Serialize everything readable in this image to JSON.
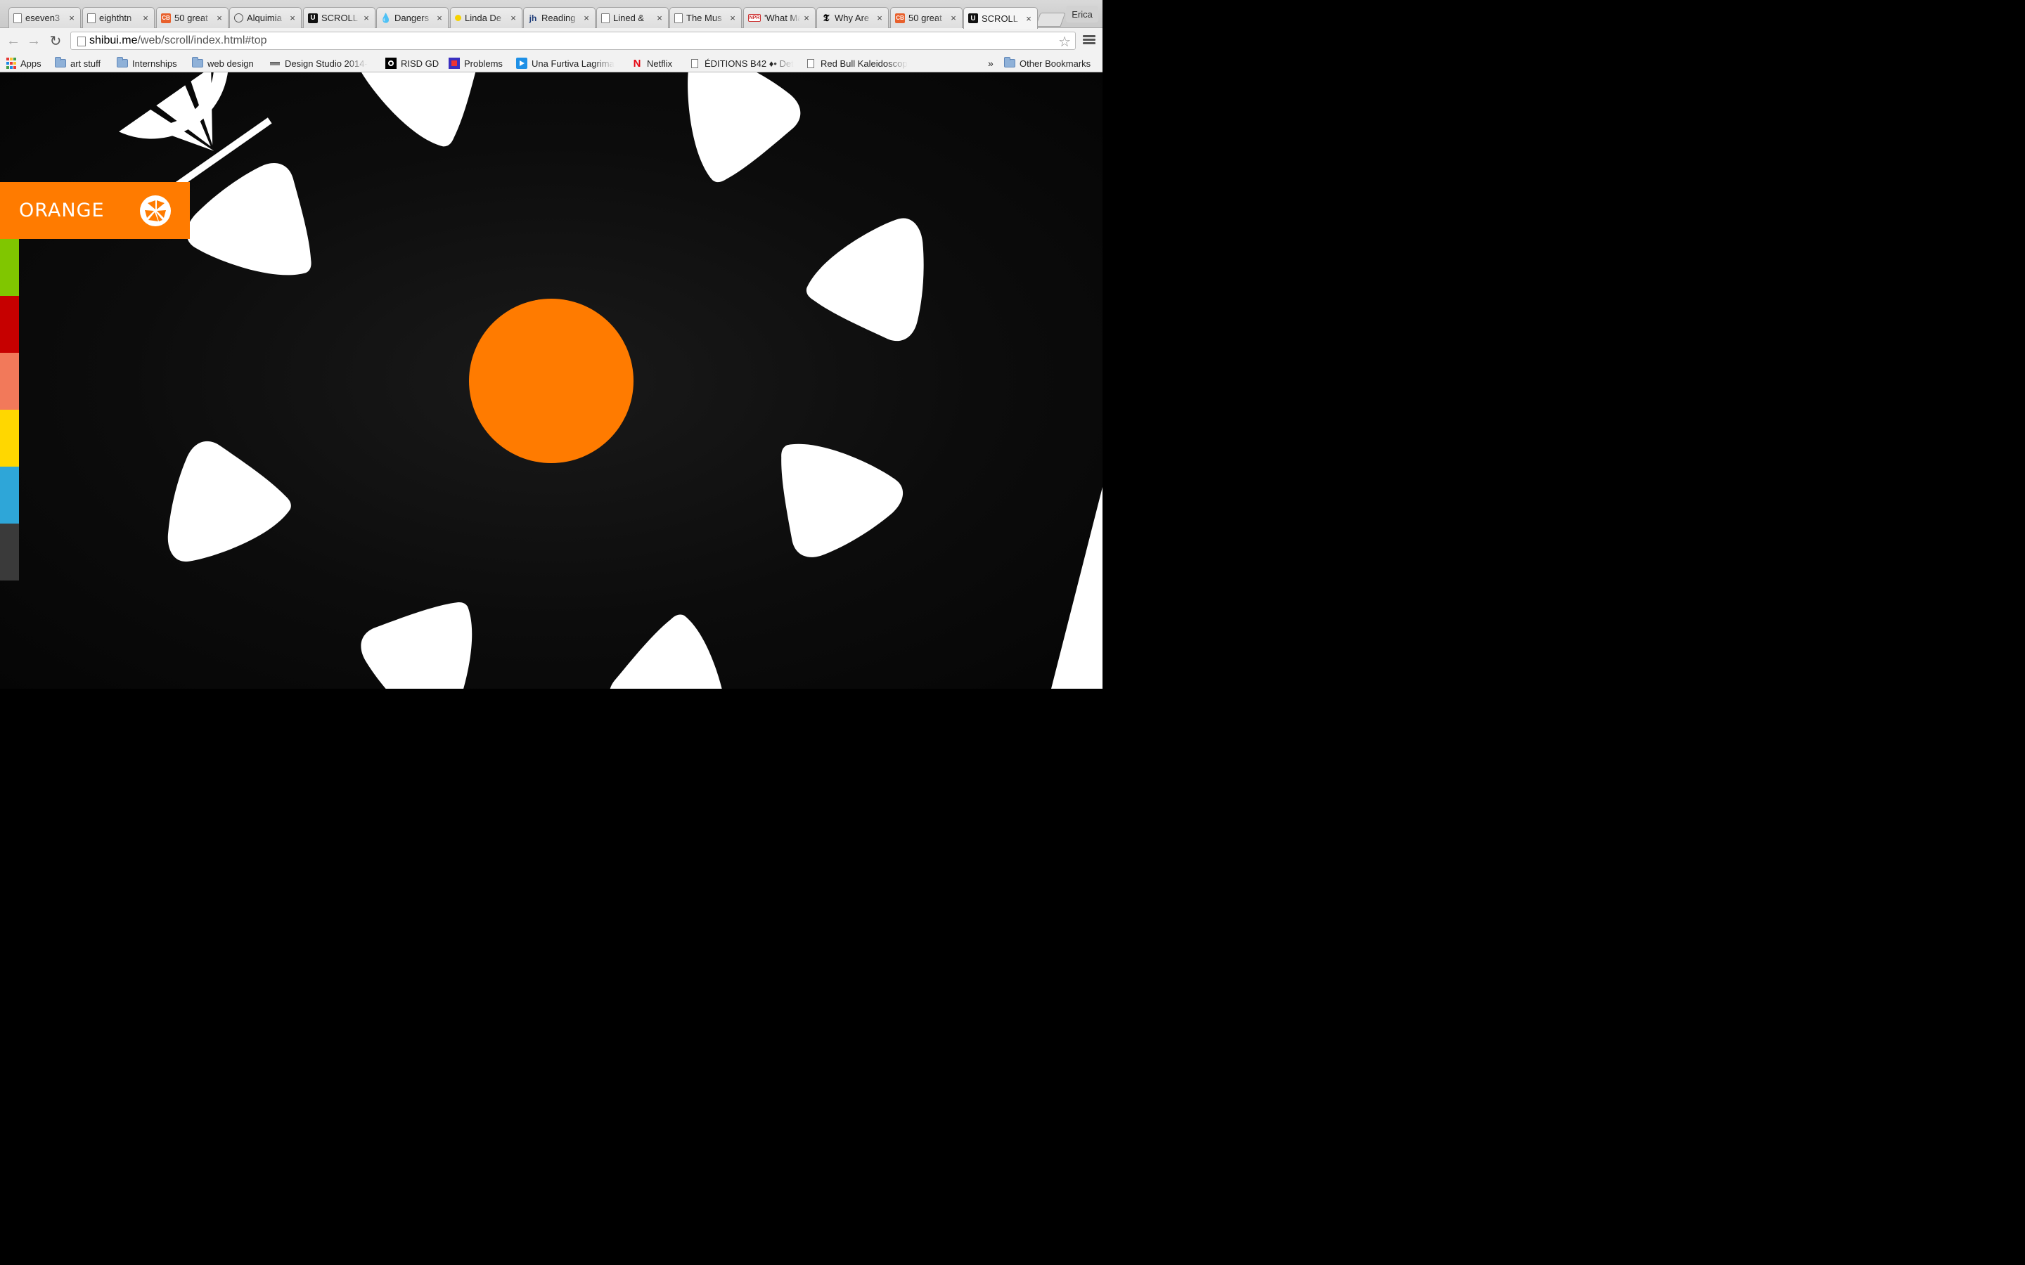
{
  "tabs": [
    {
      "title": "eseven3",
      "favicon": "page-icon",
      "active": false
    },
    {
      "title": "eighthtn",
      "favicon": "page-icon",
      "active": false
    },
    {
      "title": "50 great",
      "favicon": "cb-icon",
      "active": false
    },
    {
      "title": "Alquimia",
      "favicon": "alquimia-icon",
      "active": false
    },
    {
      "title": "SCROLL",
      "favicon": "u-icon",
      "active": false
    },
    {
      "title": "Dangers",
      "favicon": "drop-icon",
      "active": false
    },
    {
      "title": "Linda De",
      "favicon": "dot-icon",
      "active": false
    },
    {
      "title": "Reading",
      "favicon": "jh-icon",
      "active": false
    },
    {
      "title": "Lined &",
      "favicon": "page-icon",
      "active": false
    },
    {
      "title": "The Mus",
      "favicon": "page-icon",
      "active": false
    },
    {
      "title": "'What Ma",
      "favicon": "npr-icon",
      "active": false
    },
    {
      "title": "Why Are",
      "favicon": "nyt-icon",
      "active": false
    },
    {
      "title": "50 great",
      "favicon": "cb-icon",
      "active": false
    },
    {
      "title": "SCROLL",
      "favicon": "u-icon",
      "active": true
    }
  ],
  "favicon_text": {
    "cb": "CB",
    "u": "U",
    "drop": "💧",
    "jh": "jh",
    "npr": "NPR",
    "nyt": "𝕿"
  },
  "close_glyph": "×",
  "profile_name": "Erica",
  "address": {
    "host": "shibui.me",
    "path": "/web/scroll/index.html#top"
  },
  "nav_glyphs": {
    "back": "←",
    "forward": "→",
    "reload": "↻",
    "star": "☆"
  },
  "bookmarks": [
    {
      "label": "Apps",
      "icon": "apps-grid-icon"
    },
    {
      "label": "art stuff",
      "icon": "folder-icon"
    },
    {
      "label": "Internships",
      "icon": "folder-icon"
    },
    {
      "label": "web design",
      "icon": "folder-icon"
    },
    {
      "label": "Design Studio 2014-",
      "icon": "table-icon"
    },
    {
      "label": "RISD GD",
      "icon": "risd-icon"
    },
    {
      "label": "Problems",
      "icon": "problems-icon"
    },
    {
      "label": "Una Furtiva Lagrima",
      "icon": "play-icon"
    },
    {
      "label": "Netflix",
      "icon": "netflix-icon"
    },
    {
      "label": "ÉDITIONS B42 ♦• Det",
      "icon": "page-icon"
    },
    {
      "label": "Red Bull Kaleidoscop",
      "icon": "page-icon"
    }
  ],
  "bookmark_glyphs": {
    "netflix": "N",
    "overflow": "»"
  },
  "other_bookmarks": "Other Bookmarks",
  "page": {
    "section_label": "ORANGE",
    "accent": "#ff7b00",
    "swatches": [
      "#80c600",
      "#c60000",
      "#f2795a",
      "#ffd700",
      "#2ea6d8",
      "#3a3a3a"
    ]
  }
}
